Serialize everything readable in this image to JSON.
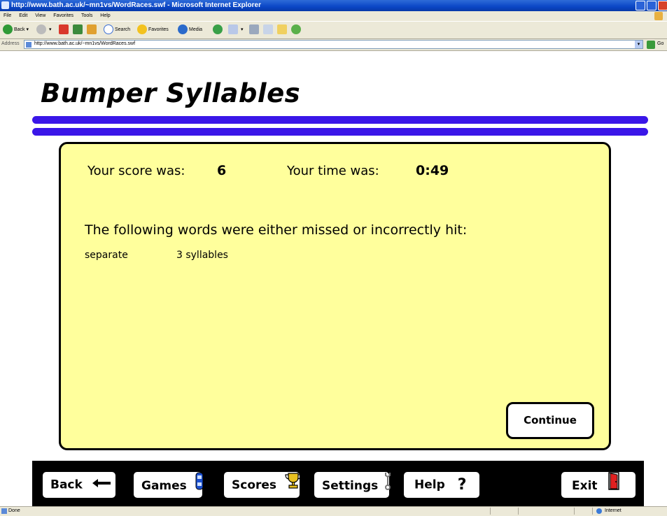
{
  "window": {
    "title": "http://www.bath.ac.uk/~mn1vs/WordRaces.swf - Microsoft Internet Explorer"
  },
  "menu": [
    "File",
    "Edit",
    "View",
    "Favorites",
    "Tools",
    "Help"
  ],
  "toolbar": {
    "back": "Back",
    "search": "Search",
    "favorites": "Favorites",
    "media": "Media"
  },
  "address": {
    "label": "Address",
    "url": "http://www.bath.ac.uk/~mn1vs/WordRaces.swf",
    "go": "Go"
  },
  "game": {
    "title": "Bumper Syllables",
    "accent_color": "#3a16e8",
    "panel_color": "#ffff9c"
  },
  "results": {
    "score_label": "Your score was:",
    "score": "6",
    "time_label": "Your time was:",
    "time": "0:49",
    "missed_heading": "The following words were either missed or incorrectly hit:",
    "missed": [
      {
        "word": "separate",
        "syllables": "3 syllables"
      }
    ],
    "continue_label": "Continue"
  },
  "nav": [
    {
      "label": "Back",
      "icon": "arrow-left-icon"
    },
    {
      "label": "Games",
      "icon": "car-icon"
    },
    {
      "label": "Scores",
      "icon": "trophy-icon"
    },
    {
      "label": "Settings",
      "icon": "wrench-icon"
    },
    {
      "label": "Help",
      "icon": "question-icon"
    },
    {
      "label": "Exit",
      "icon": "door-icon"
    }
  ],
  "status": {
    "left": "Done",
    "zone": "Internet"
  }
}
